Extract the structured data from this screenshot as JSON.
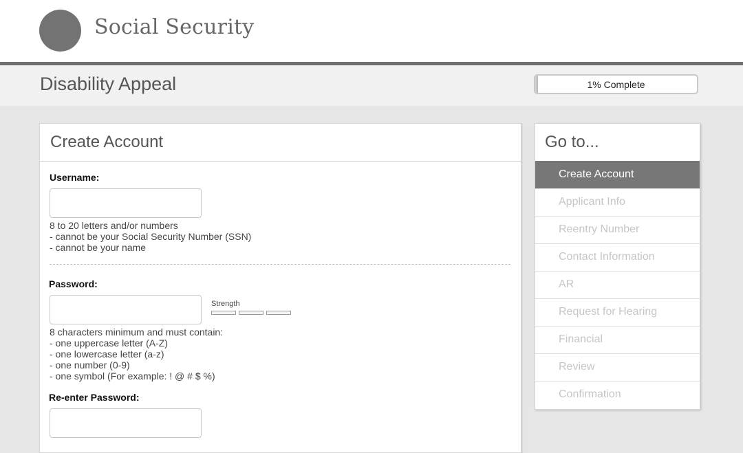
{
  "header": {
    "brand": "Social Security",
    "logo_icon": "ssa-seal-icon"
  },
  "subheader": {
    "title": "Disability Appeal",
    "progress": {
      "percent": 1,
      "label": "1% Complete"
    }
  },
  "form": {
    "title": "Create Account",
    "username": {
      "label": "Username:",
      "value": "",
      "help": [
        "8 to 20 letters and/or numbers",
        "- cannot be your Social Security Number (SSN)",
        "- cannot be your name"
      ]
    },
    "password": {
      "label": "Password:",
      "value": "",
      "strength_label": "Strength",
      "strength_segments": 3,
      "help": [
        "8 characters minimum and must contain:",
        "- one uppercase letter (A-Z)",
        "- one lowercase letter (a-z)",
        "- one number (0-9)",
        "- one symbol (For example: ! @ # $ %)"
      ]
    },
    "reenter_password": {
      "label": "Re-enter Password:",
      "value": ""
    }
  },
  "sidebar": {
    "title": "Go to...",
    "items": [
      {
        "label": "Create Account",
        "active": true
      },
      {
        "label": "Applicant Info",
        "active": false
      },
      {
        "label": "Reentry Number",
        "active": false
      },
      {
        "label": "Contact Information",
        "active": false
      },
      {
        "label": "AR",
        "active": false
      },
      {
        "label": "Request for Hearing",
        "active": false
      },
      {
        "label": "Financial",
        "active": false
      },
      {
        "label": "Review",
        "active": false
      },
      {
        "label": "Confirmation",
        "active": false
      }
    ]
  },
  "colors": {
    "active_nav_bg": "#777777",
    "disabled_nav_text": "#c6c6c6",
    "header_rule": "#6e6e6e"
  }
}
